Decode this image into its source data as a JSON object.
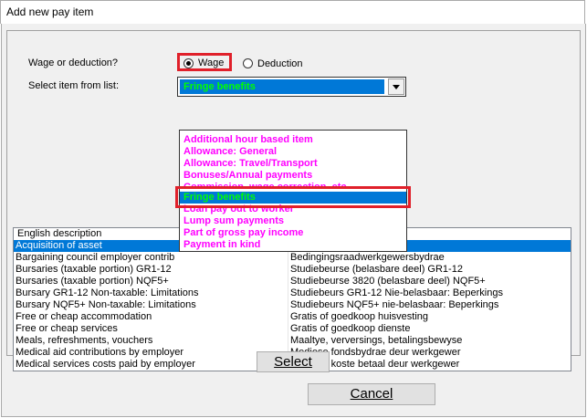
{
  "window": {
    "title": "Add new pay item"
  },
  "form": {
    "wage_or_deduction_label": "Wage or deduction?",
    "radio_wage": "Wage",
    "radio_deduction": "Deduction",
    "select_item_label": "Select item from list:",
    "combo_value": "Fringe benefits"
  },
  "dropdown": {
    "items": [
      "Additional hour based item",
      "Allowance: General",
      "Allowance: Travel/Transport",
      "Bonuses/Annual payments",
      "Commission, wage correction, etc",
      "Fringe benefits",
      "Loan pay out to worker",
      "Lump sum payments",
      "Part of gross pay income",
      "Payment in kind"
    ],
    "selected": "Fringe benefits"
  },
  "list": {
    "col1_header": "English description",
    "rows": [
      {
        "en": "Acquisition of asset",
        "af": ""
      },
      {
        "en": "Bargaining council employer contrib",
        "af": "Bedingingsraadwerkgewersbydrae"
      },
      {
        "en": "Bursaries (taxable portion) GR1-12",
        "af": "Studiebeurse (belasbare deel) GR1-12"
      },
      {
        "en": "Bursaries (taxable portion) NQF5+",
        "af": "Studiebeurse 3820 (belasbare deel) NQF5+"
      },
      {
        "en": "Bursary GR1-12 Non-taxable: Limitations",
        "af": "Studiebeurs GR1-12 Nie-belasbaar: Beperkings"
      },
      {
        "en": "Bursary NQF5+ Non-taxable: Limitations",
        "af": "Studiebeurs NQF5+ nie-belasbaar: Beperkings"
      },
      {
        "en": "Free or cheap accommodation",
        "af": "Gratis of goedkoop huisvesting"
      },
      {
        "en": "Free or cheap services",
        "af": "Gratis of goedkoop dienste"
      },
      {
        "en": "Meals, refreshments, vouchers",
        "af": "Maaltye, verversings, betalingsbewyse"
      },
      {
        "en": "Medical aid contributions by employer",
        "af": "Mediese fondsbydrae deur werkgewer"
      },
      {
        "en": "Medical services costs paid by employer",
        "af": "Mediese koste betaal deur werkgewer"
      }
    ]
  },
  "buttons": {
    "select": "Select",
    "cancel": "Cancel"
  },
  "colors": {
    "highlight_red": "#e0202a",
    "selection_blue": "#0078d7",
    "magenta": "#ff00ff",
    "green": "#00ff00"
  }
}
